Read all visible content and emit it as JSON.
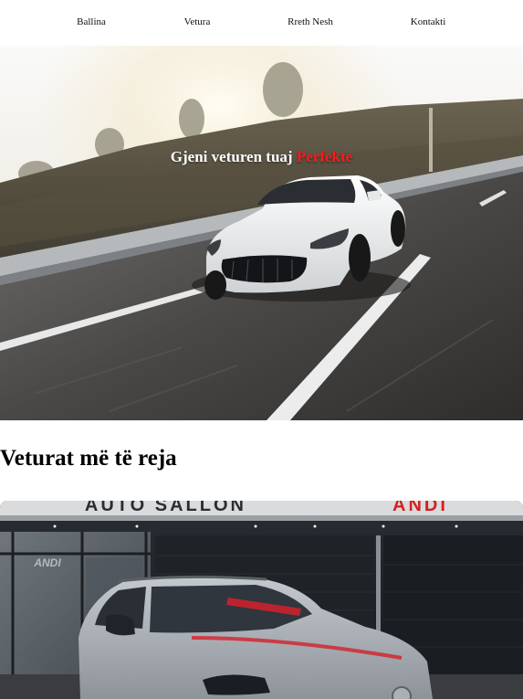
{
  "nav": {
    "items": [
      {
        "label": "Ballina"
      },
      {
        "label": "Vetura"
      },
      {
        "label": "Rreth Nesh"
      },
      {
        "label": "Kontakti"
      }
    ]
  },
  "hero": {
    "title_main": "Gjeni veturen tuaj",
    "title_accent": "Perfekte",
    "accent_color": "#ff1a1a"
  },
  "latest": {
    "heading": "Veturat më të reja"
  },
  "showroom": {
    "sign_text": "AUTO SALLON",
    "sign_brand": "ANDI",
    "window_logo": "ANDI"
  }
}
